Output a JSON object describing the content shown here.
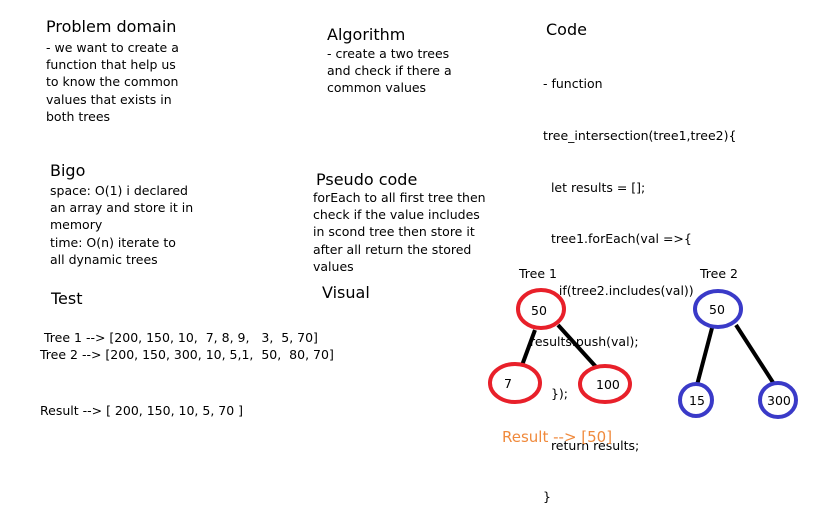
{
  "problem_domain": {
    "title": "Problem domain",
    "lines": [
      "- we want to create a",
      "function that help us",
      "to know the common",
      "values that exists in",
      "both trees"
    ]
  },
  "algorithm": {
    "title": "Algorithm",
    "lines": [
      "- create a two trees",
      "and check if there a",
      "common values"
    ]
  },
  "code": {
    "title": "Code",
    "lines": [
      "- function",
      "tree_intersection(tree1,tree2){",
      "  let results = [];",
      "  tree1.forEach(val =>{",
      "    if(tree2.includes(val))",
      "results.push(val);",
      "  });",
      "  return results;",
      "}"
    ]
  },
  "bigo": {
    "title": "Bigo",
    "lines": [
      "space: O(1) i declared",
      "an array and store it in",
      "memory",
      "time: O(n) iterate to",
      "all dynamic trees"
    ]
  },
  "pseudo": {
    "title": "Pseudo code",
    "lines": [
      "forEach to all first tree then",
      "check if the value includes",
      "in scond tree then store it",
      "after all return the stored",
      "values"
    ]
  },
  "test": {
    "title": "Test",
    "tree1": "Tree 1 --> [200, 150, 10,  7, 8, 9,   3,  5, 70]",
    "tree2": "Tree 2 --> [200, 150, 300, 10, 5,1,  50,  80, 70]",
    "result": "Result --> [ 200, 150, 10, 5, 70 ]"
  },
  "visual": {
    "title": "Visual",
    "tree1": {
      "label": "Tree 1",
      "root": "50",
      "left": "7",
      "right": "100",
      "color": "#e8202a"
    },
    "tree2": {
      "label": "Tree 2",
      "root": "50",
      "left": "15",
      "right": "300",
      "color": "#3a3ac8"
    },
    "result": "Result --> [50]",
    "result_color": "#f08a3c"
  }
}
